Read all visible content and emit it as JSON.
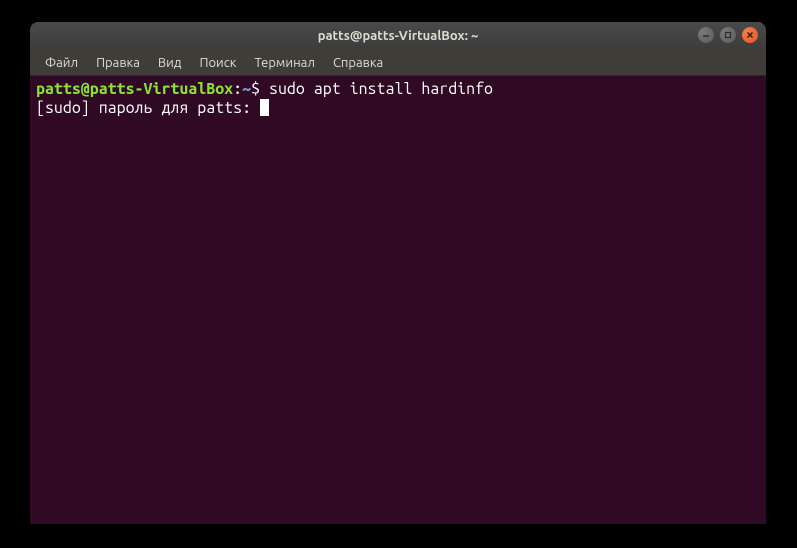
{
  "window": {
    "title": "patts@patts-VirtualBox: ~"
  },
  "menubar": {
    "items": [
      "Файл",
      "Правка",
      "Вид",
      "Поиск",
      "Терминал",
      "Справка"
    ]
  },
  "terminal": {
    "prompt": {
      "user_host": "patts@patts-VirtualBox",
      "colon": ":",
      "path": "~",
      "symbol": "$"
    },
    "command": "sudo apt install hardinfo",
    "output_line": "[sudo] пароль для patts: "
  }
}
